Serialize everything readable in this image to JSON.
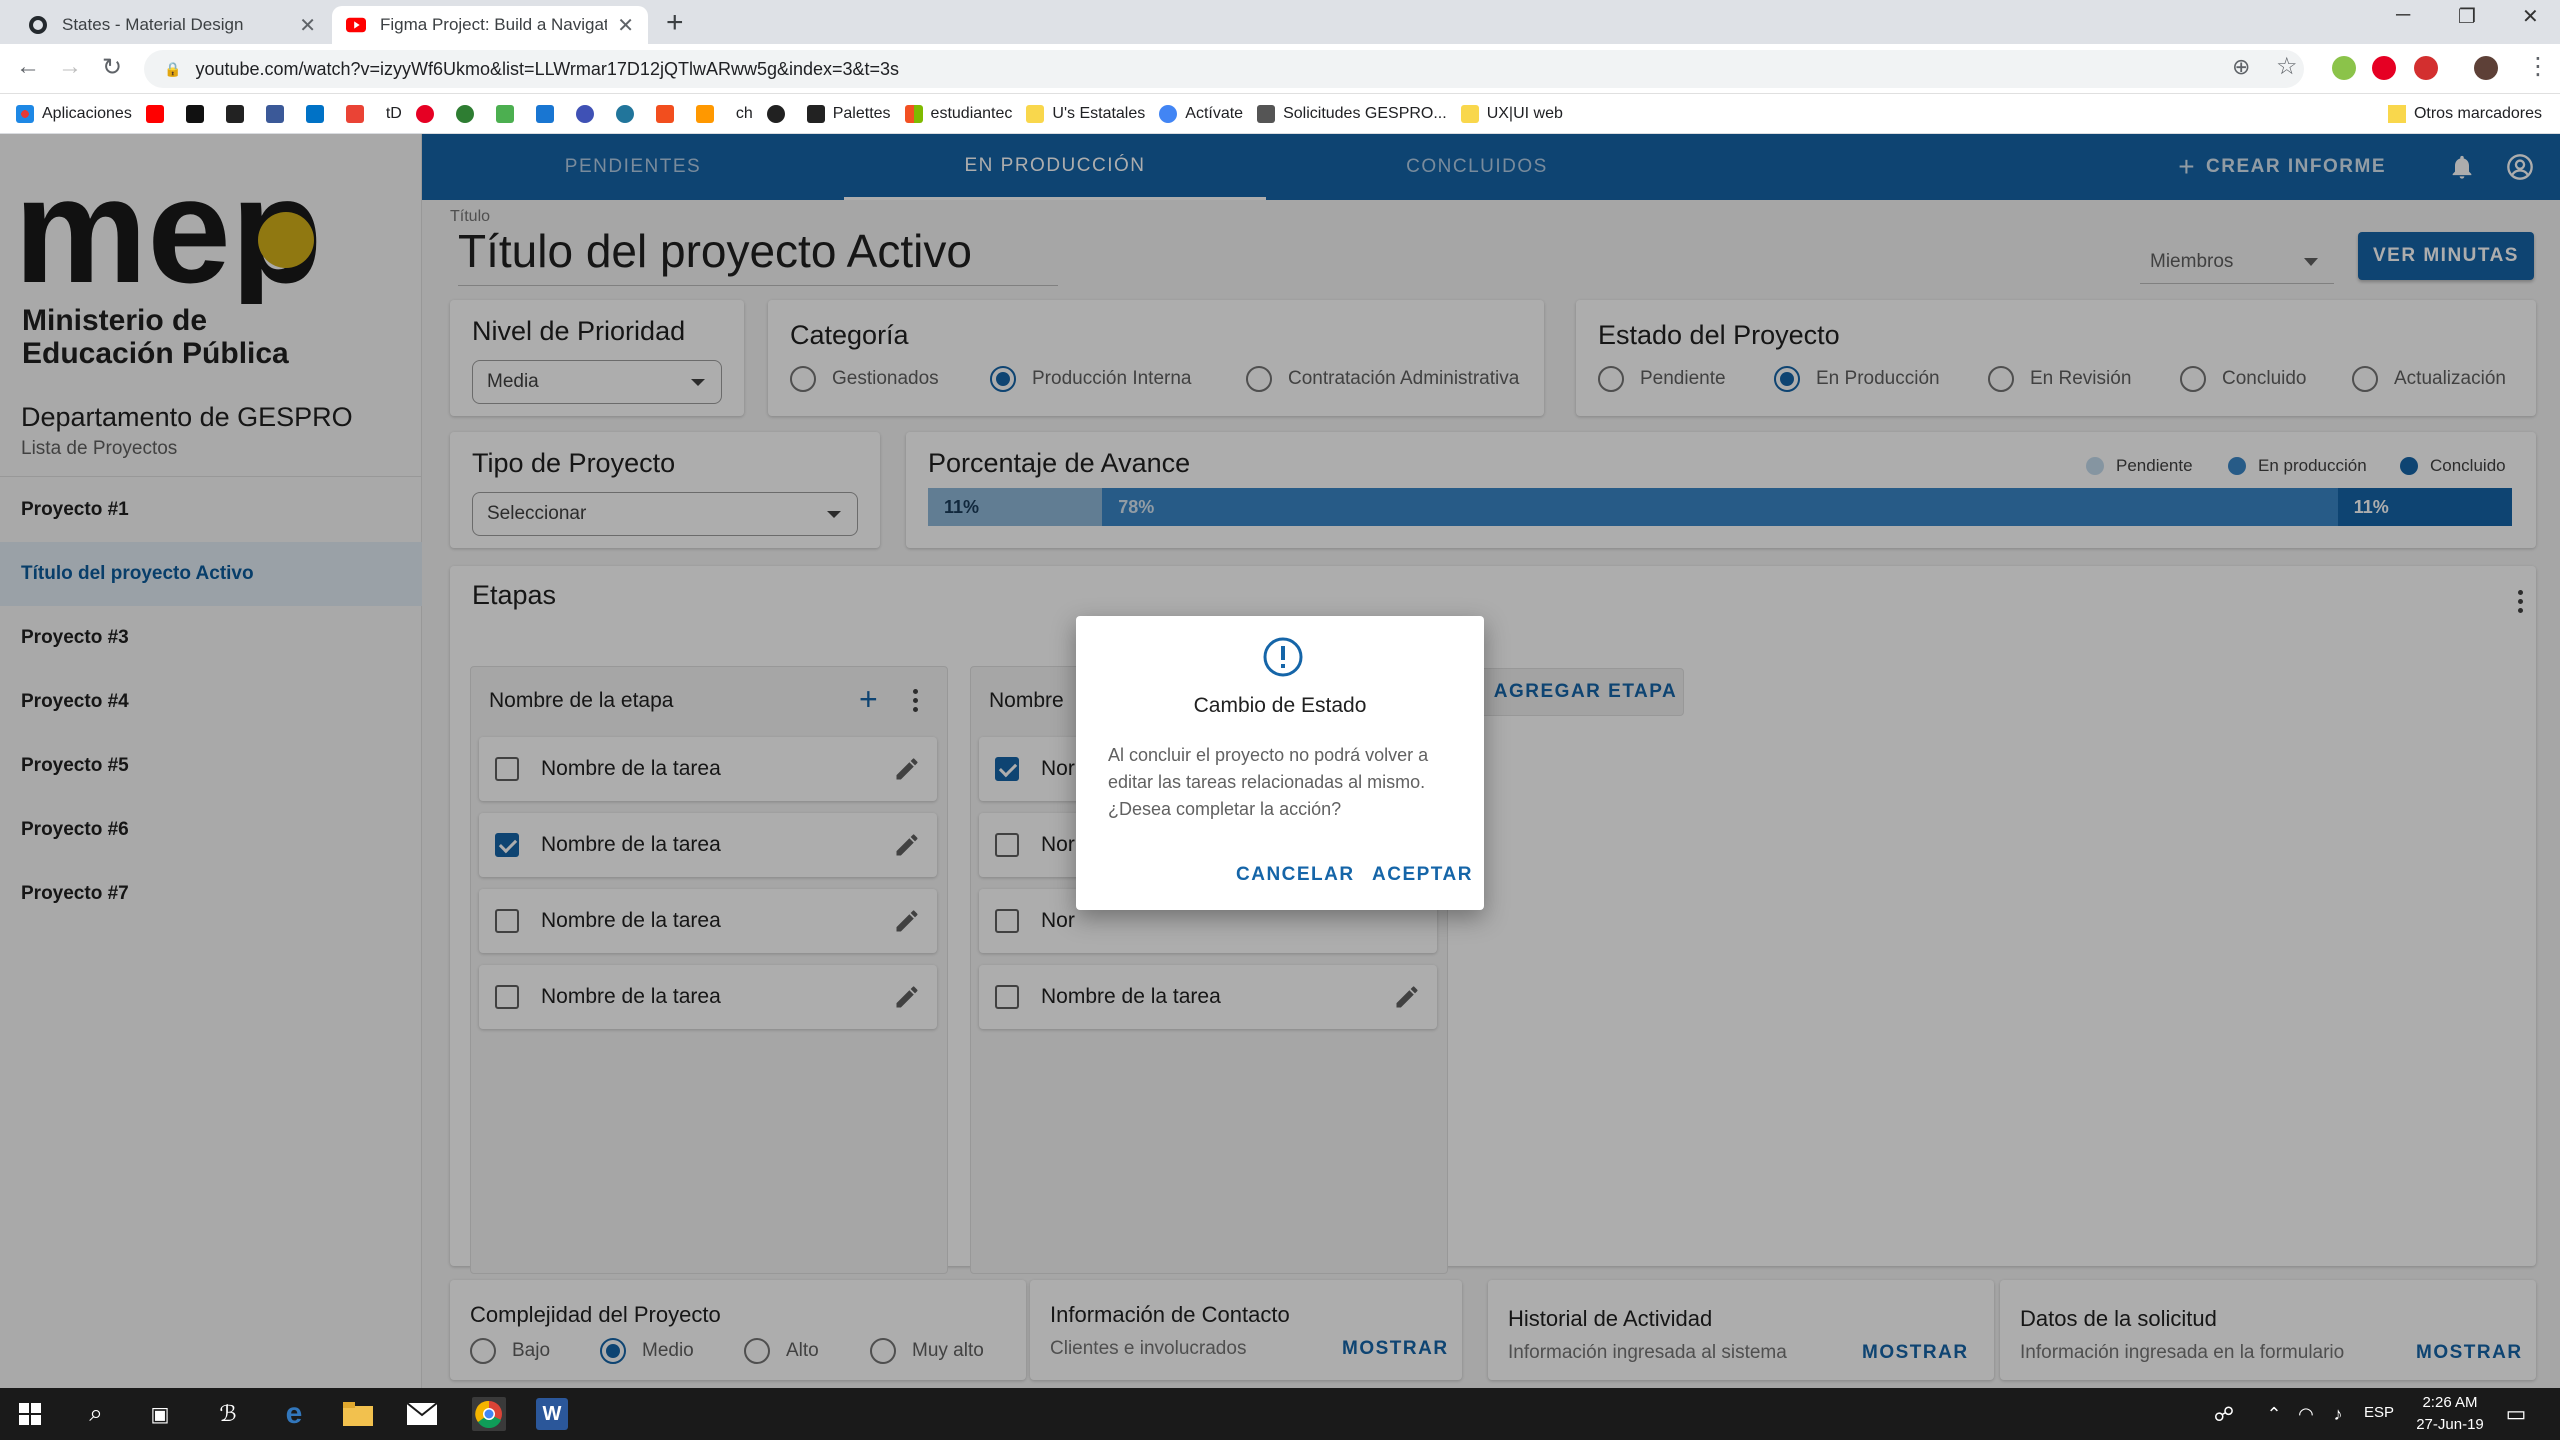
{
  "browser": {
    "tabs": [
      {
        "title": "States - Material Design"
      },
      {
        "title": "Figma Project: Build a Navigation"
      }
    ],
    "url": "youtube.com/watch?v=izyyWf6Ukmo&list=LLWrmar17D12jQTlwARww5g&index=3&t=3s",
    "bookmarks": [
      "Aplicaciones",
      "tD",
      "ch",
      "Palettes",
      "estudiantec",
      "U's Estatales",
      "Actívate",
      "Solicitudes GESPRO...",
      "UX|UI web"
    ],
    "other_bookmarks": "Otros marcadores"
  },
  "sidebar": {
    "logo_text": "mep",
    "ministerio_line1": "Ministerio de",
    "ministerio_line2": "Educación Pública",
    "department": "Departamento de GESPRO",
    "subtitle": "Lista de Proyectos",
    "items": [
      {
        "label": "Proyecto #1",
        "active": false
      },
      {
        "label": "Título del proyecto Activo",
        "active": true
      },
      {
        "label": "Proyecto #3",
        "active": false
      },
      {
        "label": "Proyecto #4",
        "active": false
      },
      {
        "label": "Proyecto #5",
        "active": false
      },
      {
        "label": "Proyecto #6",
        "active": false
      },
      {
        "label": "Proyecto #7",
        "active": false
      }
    ]
  },
  "topnav": {
    "tabs": [
      "PENDIENTES",
      "EN PRODUCCIÓN",
      "CONCLUIDOS"
    ],
    "active_tab": "EN PRODUCCIÓN",
    "crear_informe": "CREAR INFORME"
  },
  "header": {
    "title_label": "Título",
    "title_value": "Título del proyecto Activo",
    "miembros": "Miembros",
    "ver_minutas": "VER MINUTAS"
  },
  "prioridad": {
    "heading": "Nivel de Prioridad",
    "value": "Media"
  },
  "categoria": {
    "heading": "Categoría",
    "options": [
      "Gestionados",
      "Producción Interna",
      "Contratación Administrativa"
    ],
    "selected": "Producción Interna"
  },
  "estado": {
    "heading": "Estado del Proyecto",
    "options": [
      "Pendiente",
      "En Producción",
      "En Revisión",
      "Concluido",
      "Actualización"
    ],
    "selected": "En Producción"
  },
  "tipo": {
    "heading": "Tipo de Proyecto",
    "placeholder": "Seleccionar"
  },
  "avance": {
    "heading": "Porcentaje de Avance",
    "legend": [
      "Pendiente",
      "En producción",
      "Concluido"
    ],
    "segments": [
      {
        "label": "11%",
        "percent": 11,
        "color": "#8fb8d9"
      },
      {
        "label": "78%",
        "percent": 78,
        "color": "#3a86c8"
      },
      {
        "label": "11%",
        "percent": 11,
        "color": "#1565a8"
      }
    ]
  },
  "etapas": {
    "heading": "Etapas",
    "columns": [
      {
        "name": "Nombre de la etapa",
        "tasks": [
          {
            "label": "Nombre de la tarea",
            "checked": false
          },
          {
            "label": "Nombre de la tarea",
            "checked": true
          },
          {
            "label": "Nombre de la tarea",
            "checked": false
          },
          {
            "label": "Nombre de la tarea",
            "checked": false
          }
        ]
      },
      {
        "name": "Nombre",
        "tasks": [
          {
            "label": "Nor",
            "checked": true
          },
          {
            "label": "Nor",
            "checked": false
          },
          {
            "label": "Nor",
            "checked": false
          },
          {
            "label": "Nombre de la tarea",
            "checked": false
          }
        ]
      }
    ],
    "agregar": "AGREGAR ETAPA"
  },
  "complejidad": {
    "heading": "Complejidad del Proyecto",
    "options": [
      "Bajo",
      "Medio",
      "Alto",
      "Muy alto"
    ],
    "selected": "Medio"
  },
  "bottom_cards": [
    {
      "title": "Información de Contacto",
      "subtitle": "Clientes e involucrados",
      "action": "MOSTRAR"
    },
    {
      "title": "Historial de Actividad",
      "subtitle": "Información ingresada al sistema",
      "action": "MOSTRAR"
    },
    {
      "title": "Datos de la solicitud",
      "subtitle": "Información ingresada en la formulario",
      "action": "MOSTRAR"
    }
  ],
  "dialog": {
    "title": "Cambio de Estado",
    "body": "Al concluir el proyecto no podrá volver a editar las tareas relacionadas al mismo. ¿Desea completar la acción?",
    "cancel": "CANCELAR",
    "accept": "ACEPTAR"
  },
  "taskbar": {
    "lang": "ESP",
    "time": "2:26 AM",
    "date": "27-Jun-19"
  },
  "colors": {
    "primary": "#1565a8",
    "active_item_bg": "#e3eef6"
  }
}
